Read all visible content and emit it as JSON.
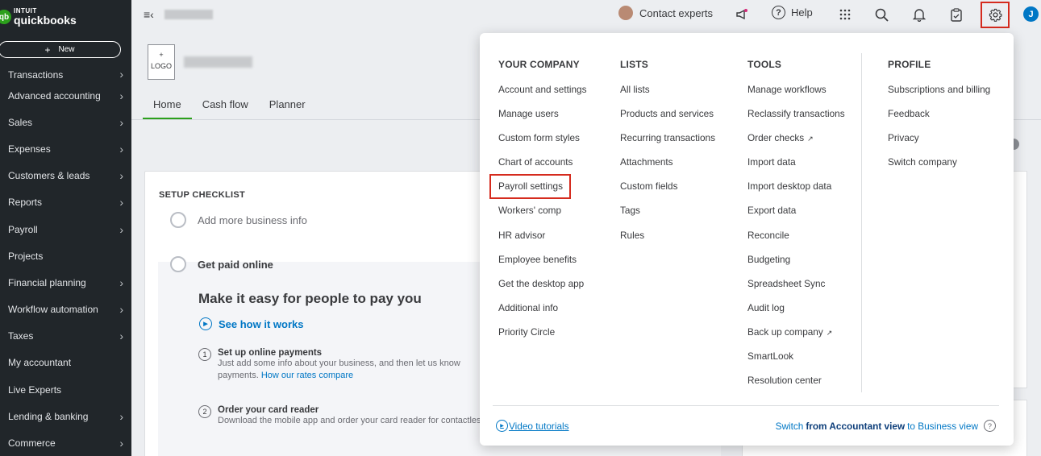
{
  "brand": {
    "intuit": "INTUIT",
    "name": "quickbooks",
    "badge": "qb"
  },
  "sidebar": {
    "new_label": "New",
    "new_plus": "+",
    "items": [
      {
        "label": "Transactions",
        "chevron": true
      },
      {
        "label": "Advanced accounting",
        "chevron": true
      },
      {
        "label": "Sales",
        "chevron": true
      },
      {
        "label": "Expenses",
        "chevron": true
      },
      {
        "label": "Customers & leads",
        "chevron": true
      },
      {
        "label": "Reports",
        "chevron": true
      },
      {
        "label": "Payroll",
        "chevron": true
      },
      {
        "label": "Projects",
        "chevron": false
      },
      {
        "label": "Financial planning",
        "chevron": true
      },
      {
        "label": "Workflow automation",
        "chevron": true
      },
      {
        "label": "Taxes",
        "chevron": true
      },
      {
        "label": "My accountant",
        "chevron": false
      },
      {
        "label": "Live Experts",
        "chevron": false
      },
      {
        "label": "Lending & banking",
        "chevron": true
      },
      {
        "label": "Commerce",
        "chevron": true
      }
    ]
  },
  "topbar": {
    "contact_experts": "Contact experts",
    "help": "Help",
    "user_initial": "J"
  },
  "main": {
    "logo_plus": "+",
    "logo_label": "LOGO",
    "tabs": [
      "Home",
      "Cash flow",
      "Planner"
    ],
    "checklist": {
      "title": "SETUP CHECKLIST",
      "item1": "Add more business info",
      "item2": "Get paid online",
      "headline": "Make it easy for people to pay you",
      "see_how": "See how it works",
      "steps": [
        {
          "num": "1",
          "title": "Set up online payments",
          "desc": "Just add some info about your business, and then let us know",
          "desc2": "payments.",
          "link": "How our rates compare"
        },
        {
          "num": "2",
          "title": "Order your card reader",
          "desc": "Download the mobile app and order your card reader for contactless, in-person payments."
        }
      ]
    }
  },
  "settings_menu": {
    "columns": [
      {
        "heading": "YOUR COMPANY",
        "items": [
          {
            "label": "Account and settings"
          },
          {
            "label": "Manage users"
          },
          {
            "label": "Custom form styles"
          },
          {
            "label": "Chart of accounts"
          },
          {
            "label": "Payroll settings"
          },
          {
            "label": "Workers' comp"
          },
          {
            "label": "HR advisor"
          },
          {
            "label": "Employee benefits"
          },
          {
            "label": "Get the desktop app"
          },
          {
            "label": "Additional info"
          },
          {
            "label": "Priority Circle"
          }
        ]
      },
      {
        "heading": "LISTS",
        "items": [
          {
            "label": "All lists"
          },
          {
            "label": "Products and services"
          },
          {
            "label": "Recurring transactions"
          },
          {
            "label": "Attachments"
          },
          {
            "label": "Custom fields"
          },
          {
            "label": "Tags"
          },
          {
            "label": "Rules"
          }
        ]
      },
      {
        "heading": "TOOLS",
        "items": [
          {
            "label": "Manage workflows"
          },
          {
            "label": "Reclassify transactions"
          },
          {
            "label": "Order checks",
            "external": true
          },
          {
            "label": "Import data"
          },
          {
            "label": "Import desktop data"
          },
          {
            "label": "Export data"
          },
          {
            "label": "Reconcile"
          },
          {
            "label": "Budgeting"
          },
          {
            "label": "Spreadsheet Sync"
          },
          {
            "label": "Audit log"
          },
          {
            "label": "Back up company",
            "external": true
          },
          {
            "label": "SmartLook"
          },
          {
            "label": "Resolution center"
          }
        ]
      },
      {
        "heading": "PROFILE",
        "items": [
          {
            "label": "Subscriptions and billing"
          },
          {
            "label": "Feedback"
          },
          {
            "label": "Privacy"
          },
          {
            "label": "Switch company"
          }
        ]
      }
    ],
    "footer": {
      "video_tutorials": "Video tutorials",
      "switch_prefix": "Switch",
      "switch_bold": "from Accountant view",
      "switch_suffix": "to Business view"
    }
  },
  "colors": {
    "accent_green": "#2ca01c",
    "link_blue": "#0077c5",
    "highlight_red": "#d52b1e",
    "sidebar_bg": "#21262a"
  }
}
